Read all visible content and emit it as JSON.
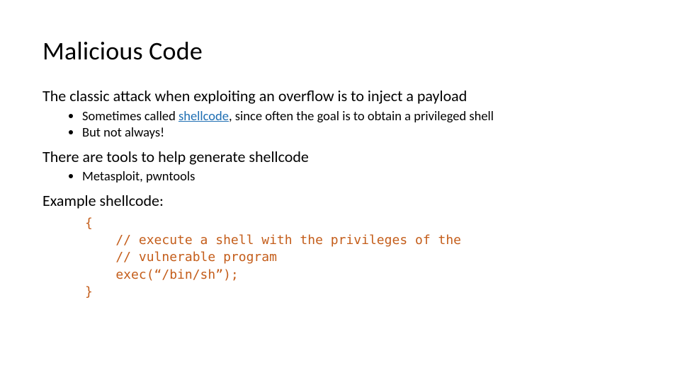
{
  "title": "Malicious Code",
  "body": {
    "line1": "The classic attack when exploiting an overflow is to inject a payload",
    "sub1": {
      "a_prefix": "Sometimes called ",
      "a_link": "shellcode",
      "a_suffix": ", since often the goal is to obtain a privileged shell",
      "b": "But not always!"
    },
    "line2": "There are tools to help generate shellcode",
    "sub2": {
      "a": "Metasploit, pwntools"
    },
    "line3": "Example shellcode:",
    "code": {
      "l1": "{",
      "l2": "    // execute a shell with the privileges of the",
      "l3": "    // vulnerable program",
      "l4": "    exec(“/bin/sh”);",
      "l5": "}"
    }
  }
}
